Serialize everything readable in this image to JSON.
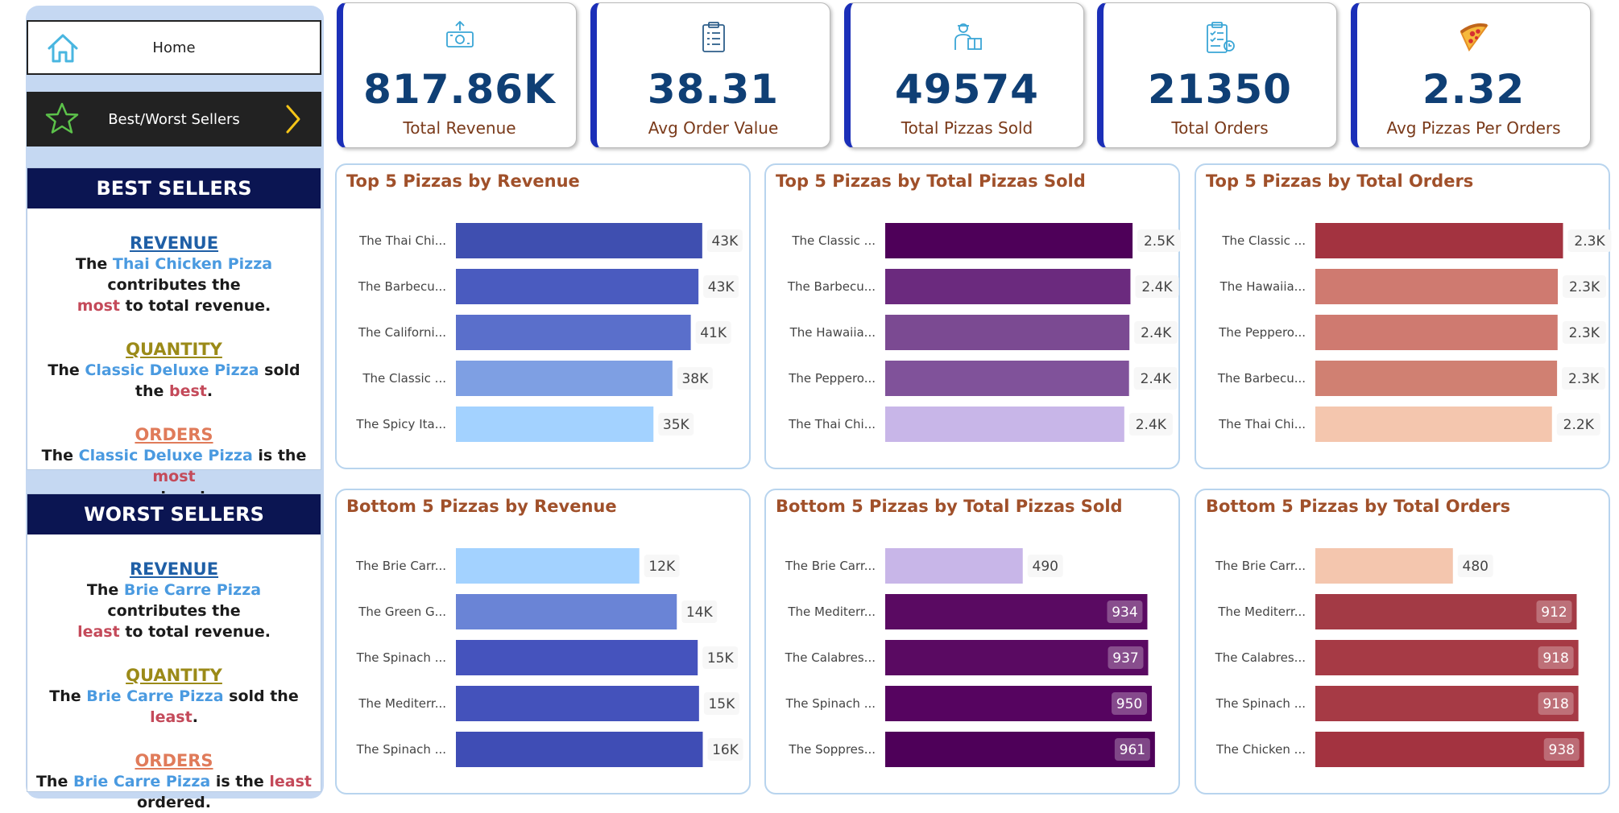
{
  "nav": {
    "home_label": "Home",
    "bws_label": "Best/Worst Sellers"
  },
  "best": {
    "header": "BEST SELLERS",
    "revenue": {
      "title": "REVENUE",
      "pre": "The ",
      "item": "Thai Chicken Pizza",
      "mid": " contributes the",
      "emph": "most",
      "post": " to total revenue."
    },
    "quantity": {
      "title": "QUANTITY",
      "pre": "The ",
      "item": "Classic Deluxe Pizza",
      "mid": " sold the ",
      "emph": "best",
      "post": "."
    },
    "orders": {
      "title": "ORDERS",
      "pre": "The ",
      "item": "Classic Deluxe Pizza",
      "mid": " is the ",
      "emph": "most",
      "post": "ordered."
    }
  },
  "worst": {
    "header": "WORST SELLERS",
    "revenue": {
      "title": "REVENUE",
      "pre": "The ",
      "item": "Brie Carre Pizza",
      "mid": " contributes the",
      "emph": "least",
      "post": " to total revenue."
    },
    "quantity": {
      "title": "QUANTITY",
      "pre": "The ",
      "item": "Brie Carre Pizza",
      "mid": " sold the ",
      "emph": "least",
      "post": "."
    },
    "orders": {
      "title": "ORDERS",
      "pre": "The ",
      "item": "Brie Carre Pizza",
      "mid": " is the ",
      "emph": "least",
      "post": "ordered."
    }
  },
  "kpis": [
    {
      "value": "817.86K",
      "label": "Total Revenue",
      "icon": "money-icon"
    },
    {
      "value": "38.31",
      "label": "Avg Order Value",
      "icon": "clipboard-icon"
    },
    {
      "value": "49574",
      "label": "Total Pizzas Sold",
      "icon": "delivery-icon"
    },
    {
      "value": "21350",
      "label": "Total Orders",
      "icon": "order-list-icon"
    },
    {
      "value": "2.32",
      "label": "Avg Pizzas Per Orders",
      "icon": "pizza-slice-icon"
    }
  ],
  "chart_data": [
    {
      "type": "bar",
      "orientation": "horizontal",
      "title": "Top 5 Pizzas by Revenue",
      "categories": [
        "The Thai Chi...",
        "The Barbecu...",
        "The Californi...",
        "The Classic ...",
        "The Spicy Ita..."
      ],
      "values": [
        43434,
        42768,
        41410,
        38180,
        34831
      ],
      "value_labels": [
        "43K",
        "43K",
        "41K",
        "38K",
        "35K"
      ],
      "colors": [
        "#3f4fb0",
        "#4a5bbf",
        "#5a6fcb",
        "#7e9fe3",
        "#a3d2ff"
      ],
      "label_position": "outside",
      "xlim": [
        0,
        48000
      ]
    },
    {
      "type": "bar",
      "orientation": "horizontal",
      "title": "Top 5 Pizzas by Total Pizzas Sold",
      "categories": [
        "The Classic ...",
        "The Barbecu...",
        "The Hawaiia...",
        "The Peppero...",
        "The Thai Chi..."
      ],
      "values": [
        2453,
        2432,
        2422,
        2418,
        2371
      ],
      "value_labels": [
        "2.5K",
        "2.4K",
        "2.4K",
        "2.4K",
        "2.4K"
      ],
      "colors": [
        "#4e0059",
        "#6b2a7e",
        "#7b4a92",
        "#80529a",
        "#c8b6e8"
      ],
      "label_position": "outside",
      "xlim": [
        0,
        2700
      ]
    },
    {
      "type": "bar",
      "orientation": "horizontal",
      "title": "Top 5 Pizzas by Total Orders",
      "categories": [
        "The Classic ...",
        "The Hawaiia...",
        "The Peppero...",
        "The Barbecu...",
        "The Thai Chi..."
      ],
      "values": [
        2329,
        2280,
        2278,
        2273,
        2225
      ],
      "value_labels": [
        "2.3K",
        "2.3K",
        "2.3K",
        "2.3K",
        "2.2K"
      ],
      "colors": [
        "#a33340",
        "#cf7a70",
        "#cf7a70",
        "#d08072",
        "#f4c6ae"
      ],
      "label_position": "outside",
      "xlim": [
        0,
        2560
      ]
    },
    {
      "type": "bar",
      "orientation": "horizontal",
      "title": "Bottom 5 Pizzas by Revenue",
      "categories": [
        "The Brie Carr...",
        "The Green G...",
        "The Spinach ...",
        "The Mediterr...",
        "The Spinach ..."
      ],
      "values": [
        11588,
        13956,
        15277,
        15360,
        15596
      ],
      "value_labels": [
        "12K",
        "14K",
        "15K",
        "15K",
        "16K"
      ],
      "colors": [
        "#a3d2ff",
        "#6a84d6",
        "#4553bd",
        "#4452bb",
        "#3f4db5"
      ],
      "label_position": "outside",
      "xlim": [
        0,
        17200
      ]
    },
    {
      "type": "bar",
      "orientation": "horizontal",
      "title": "Bottom 5 Pizzas by Total Pizzas Sold",
      "categories": [
        "The Brie Carr...",
        "The Mediterr...",
        "The Calabres...",
        "The Spinach ...",
        "The Soppres..."
      ],
      "values": [
        490,
        934,
        937,
        950,
        961
      ],
      "value_labels": [
        "490",
        "934",
        "937",
        "950",
        "961"
      ],
      "colors": [
        "#c8b6e8",
        "#5a0a62",
        "#5a0a62",
        "#560460",
        "#4e0059"
      ],
      "label_position": [
        "outside",
        "inside",
        "inside",
        "inside",
        "inside"
      ],
      "xlim": [
        0,
        970
      ]
    },
    {
      "type": "bar",
      "orientation": "horizontal",
      "title": "Bottom 5 Pizzas by Total Orders",
      "categories": [
        "The Brie Carr...",
        "The Mediterr...",
        "The Calabres...",
        "The Spinach ...",
        "The Chicken ..."
      ],
      "values": [
        480,
        912,
        918,
        918,
        938
      ],
      "value_labels": [
        "480",
        "912",
        "918",
        "918",
        "938"
      ],
      "colors": [
        "#f4c6ae",
        "#a33a45",
        "#a63a45",
        "#a63a45",
        "#a33340"
      ],
      "label_position": [
        "outside",
        "inside",
        "inside",
        "inside",
        "inside"
      ],
      "xlim": [
        0,
        950
      ]
    }
  ]
}
